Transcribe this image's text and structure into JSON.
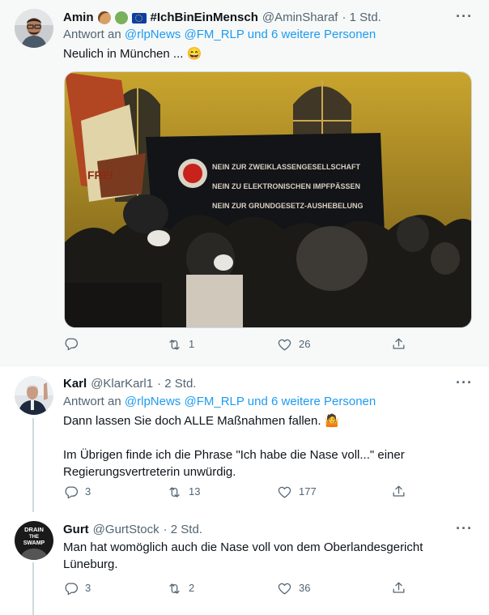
{
  "tweets": [
    {
      "name": "Amin",
      "badges_text": "#IchBinEinMensch",
      "handle": "@AminSharaf",
      "time": "· 1 Std.",
      "reply_prefix": "Antwort an",
      "reply_targets": "@rlpNews @FM_RLP",
      "reply_suffix": "und 6 weitere Personen",
      "text": "Neulich in München ... 😄",
      "counts": {
        "reply": "",
        "retweet": "1",
        "like": "26"
      },
      "media_text": [
        "NEIN ZUR ZWEIKLASSENGESELLSCHAFT",
        "NEIN ZU ELEKTRONISCHEN IMPFPÄSSEN",
        "NEIN ZUR GRUNDGESETZ-AUSHEBELUNG",
        "FREI"
      ]
    },
    {
      "name": "Karl",
      "handle": "@KlarKarl1",
      "time": "· 2 Std.",
      "reply_prefix": "Antwort an",
      "reply_targets": "@rlpNews @FM_RLP",
      "reply_suffix": "und 6 weitere Personen",
      "text_1": "Dann lassen Sie doch ALLE Maßnahmen fallen. 🤷",
      "text_2": "Im Übrigen finde ich die Phrase \"Ich habe die Nase voll...\" einer Regierungsvertreterin unwürdig.",
      "counts": {
        "reply": "3",
        "retweet": "13",
        "like": "177"
      }
    },
    {
      "name": "Gurt",
      "handle": "@GurtStock",
      "time": "· 2 Std.",
      "avatar_text": [
        "DRAIN",
        "THE",
        "SWAMP"
      ],
      "text": "Man hat womöglich auch die Nase voll von dem Oberlandesgericht Lüneburg.",
      "counts": {
        "reply": "3",
        "retweet": "2",
        "like": "36"
      }
    }
  ],
  "colors": {
    "link": "#1d9bf0",
    "secondary": "#536471",
    "highlight_bg": "#f7f9f9"
  },
  "icons": [
    "reply-icon",
    "retweet-icon",
    "like-icon",
    "share-icon",
    "more-icon"
  ]
}
